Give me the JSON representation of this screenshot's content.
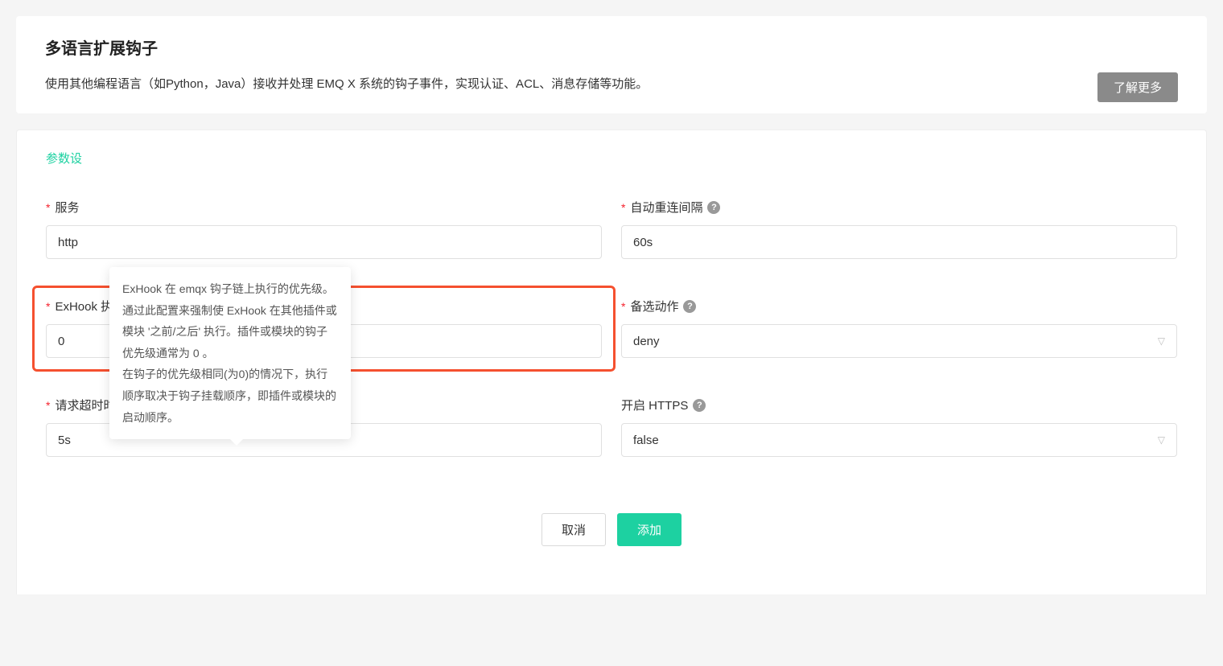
{
  "header": {
    "title": "多语言扩展钩子",
    "description": "使用其他编程语言（如Python，Java）接收并处理 EMQ X 系统的钩子事件，实现认证、ACL、消息存储等功能。",
    "learn_more": "了解更多"
  },
  "section": {
    "title": "参数设"
  },
  "tooltip": {
    "content": "ExHook 在 emqx 钩子链上执行的优先级。\n通过此配置来强制使 ExHook 在其他插件或模块 '之前/之后' 执行。插件或模块的钩子优先级通常为 0 。\n在钩子的优先级相同(为0)的情况下，执行顺序取决于钩子挂载顺序，即插件或模块的启动顺序。"
  },
  "fields": {
    "server_url": {
      "label": "服务",
      "required": true,
      "value": "http"
    },
    "reconnect_interval": {
      "label": "自动重连间隔",
      "required": true,
      "value": "60s"
    },
    "priority": {
      "label": "ExHook 执行优先级",
      "required": true,
      "value": "0"
    },
    "failed_action": {
      "label": "备选动作",
      "required": true,
      "value": "deny"
    },
    "request_timeout": {
      "label": "请求超时时间",
      "required": true,
      "value": "5s"
    },
    "enable_https": {
      "label": "开启 HTTPS",
      "required": false,
      "value": "false"
    }
  },
  "actions": {
    "cancel": "取消",
    "submit": "添加"
  }
}
